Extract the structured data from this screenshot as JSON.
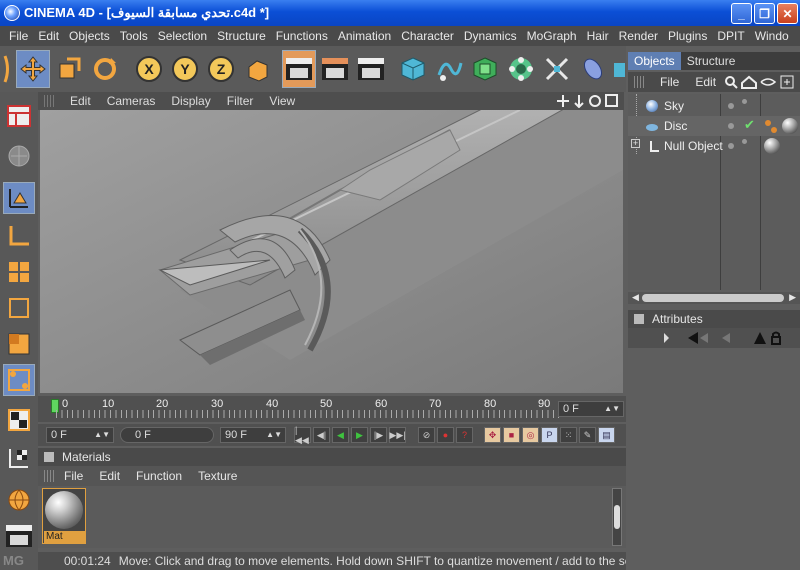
{
  "window": {
    "title": "CINEMA 4D - [تحدي مسابقة السيوف.c4d *]",
    "minimize_label": "_",
    "maximize_label": "❐",
    "close_label": "✕"
  },
  "menubar": {
    "items": [
      "File",
      "Edit",
      "Objects",
      "Tools",
      "Selection",
      "Structure",
      "Functions",
      "Animation",
      "Character",
      "Dynamics",
      "MoGraph",
      "Hair",
      "Render",
      "Plugins",
      "DPIT",
      "Windo"
    ]
  },
  "toolbar": {
    "axis_x": "X",
    "axis_y": "Y",
    "axis_z": "Z"
  },
  "viewport": {
    "menu": [
      "Edit",
      "Cameras",
      "Display",
      "Filter",
      "View"
    ]
  },
  "timeline": {
    "ticks": [
      "0",
      "10",
      "20",
      "30",
      "40",
      "50",
      "60",
      "70",
      "80",
      "90"
    ],
    "current_frame": "0 F",
    "start_frame": "0 F",
    "min_frame": "0 F",
    "end_frame": "90 F"
  },
  "materials": {
    "title": "Materials",
    "menu": [
      "File",
      "Edit",
      "Function",
      "Texture"
    ],
    "items": [
      {
        "name": "Mat"
      }
    ]
  },
  "status": {
    "time": "00:01:24",
    "message": "Move: Click and drag to move elements. Hold down SHIFT to quantize movement / add to the selection in p"
  },
  "objects_panel": {
    "tabs": [
      "Objects",
      "Structure"
    ],
    "menu": [
      "File",
      "Edit"
    ],
    "objects": [
      {
        "name": "Sky"
      },
      {
        "name": "Disc"
      },
      {
        "name": "Null Object"
      }
    ]
  },
  "attributes_panel": {
    "title": "Attributes"
  },
  "colors": {
    "accent_selected": "#6d8cc4",
    "tab_active": "#5f7fb3",
    "material_highlight": "#e0a040"
  }
}
